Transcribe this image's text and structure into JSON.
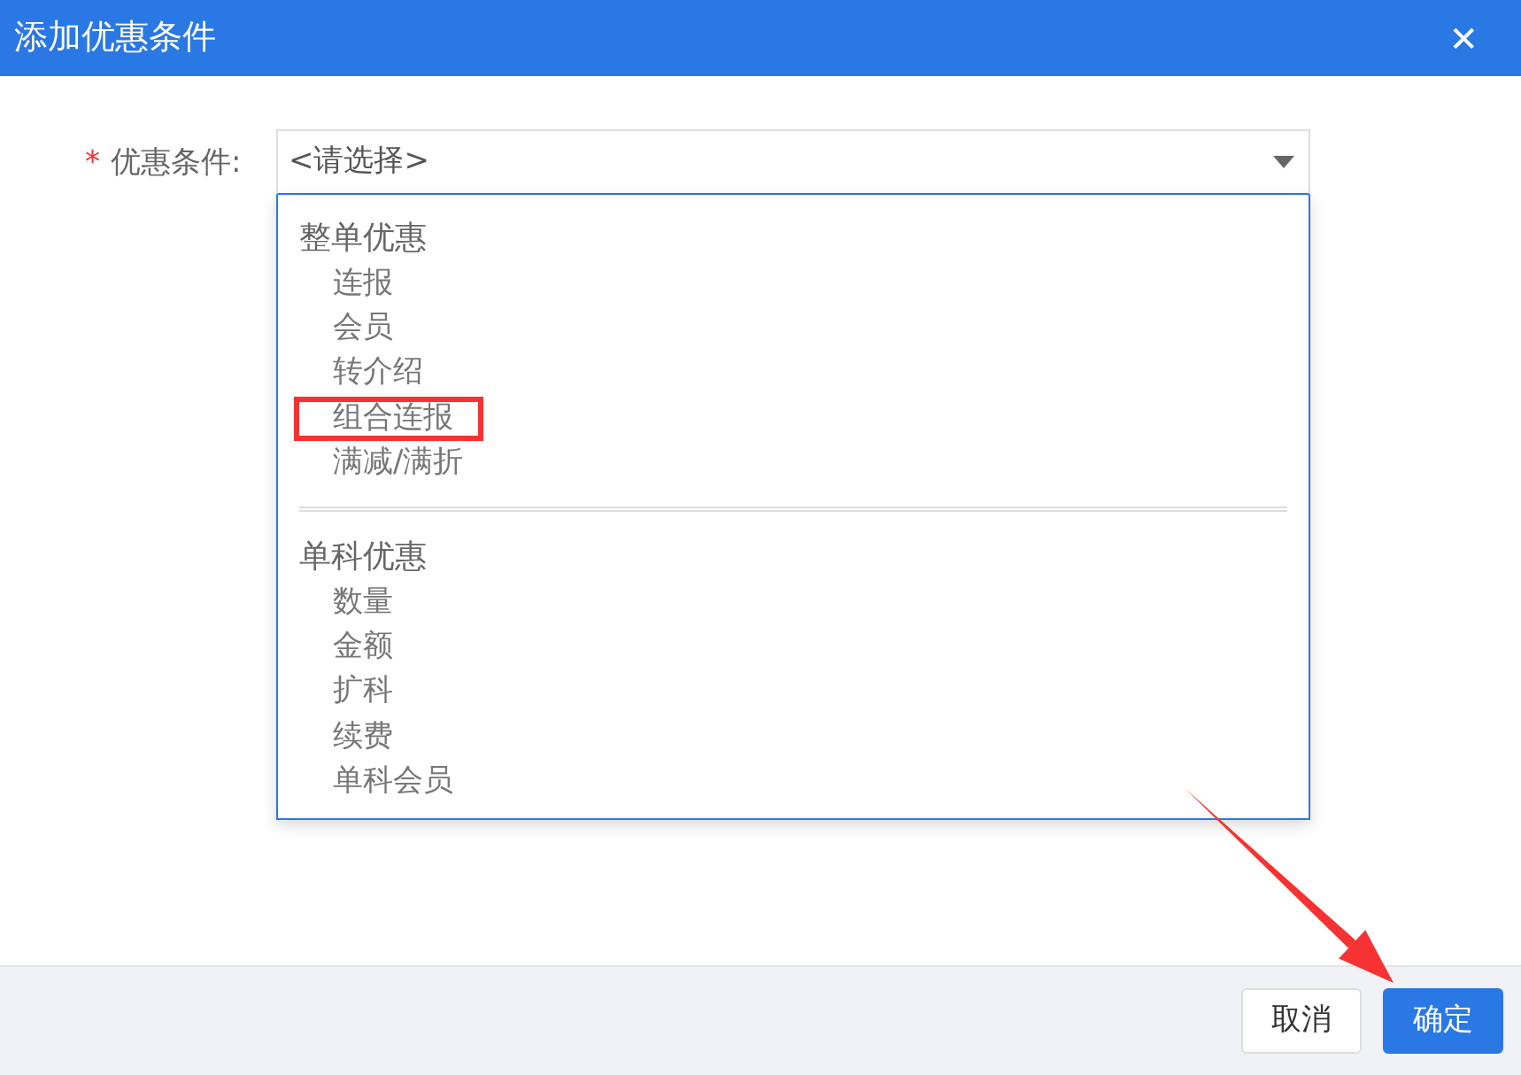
{
  "window": {
    "title": "添加优惠条件",
    "close": "✕"
  },
  "field": {
    "required_mark": "*",
    "label": "优惠条件:",
    "placeholder": "<请选择>",
    "expanded": true
  },
  "dropdown": {
    "groups": [
      {
        "label": "整单优惠",
        "items": [
          {
            "label": "连报",
            "highlighted": false
          },
          {
            "label": "会员",
            "highlighted": false
          },
          {
            "label": "转介绍",
            "highlighted": false
          },
          {
            "label": "组合连报",
            "highlighted": true
          },
          {
            "label": "满减/满折",
            "highlighted": false
          }
        ]
      },
      {
        "label": "单科优惠",
        "items": [
          {
            "label": "数量",
            "highlighted": false
          },
          {
            "label": "金额",
            "highlighted": false
          },
          {
            "label": "扩科",
            "highlighted": false
          },
          {
            "label": "续费",
            "highlighted": false
          },
          {
            "label": "单科会员",
            "highlighted": false
          }
        ]
      }
    ]
  },
  "buttons": [
    {
      "label": "取消",
      "kind": "secondary"
    },
    {
      "label": "确定",
      "kind": "primary"
    }
  ],
  "arrow_to_confirm": true
}
